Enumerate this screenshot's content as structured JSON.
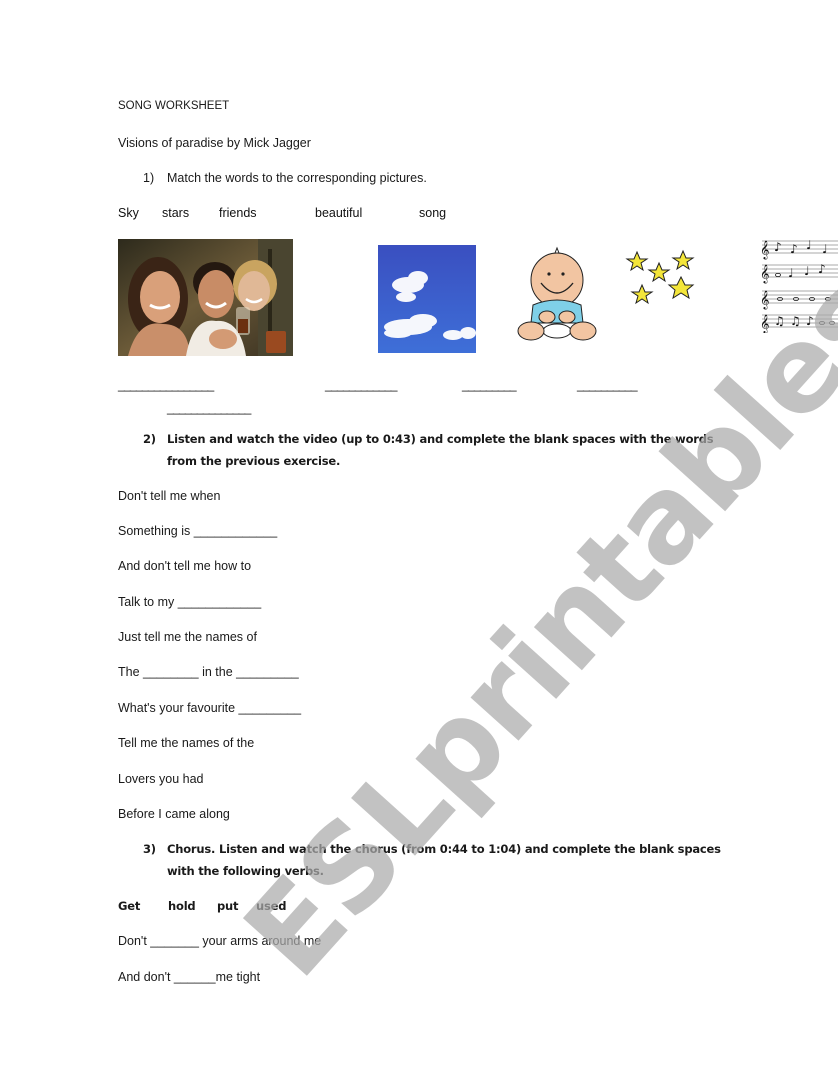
{
  "header": {
    "title": "SONG WORKSHEET",
    "subtitle": "Visions of paradise by Mick Jagger"
  },
  "exercise1": {
    "number": "1)",
    "instruction": "Match the words to the corresponding pictures.",
    "words": [
      "Sky",
      "stars",
      "friends",
      "beautiful",
      "song"
    ],
    "pictures": [
      "friends-photo",
      "sky-photo",
      "baby-clipart",
      "stars-clipart",
      "music-sheet-clipart"
    ],
    "answer_blanks": [
      "________________",
      "____________",
      "_________",
      "__________",
      "______________"
    ]
  },
  "exercise2": {
    "number": "2)",
    "instruction_line1": "Listen and watch the video (up to 0:43) and complete the blank spaces with the words",
    "instruction_line2": "from the previous exercise.",
    "lyrics": [
      "Don't tell me when",
      "Something is ____________",
      "And don't tell me how to",
      "Talk to my ____________",
      "Just tell me the names of",
      "The ________ in the _________",
      "What's your favourite _________",
      "Tell me the names of the",
      "Lovers you had",
      "Before I came along"
    ]
  },
  "exercise3": {
    "number": "3)",
    "instruction_line1": "Chorus. Listen and watch the chorus (from 0:44 to 1:04) and complete the blank spaces",
    "instruction_line2": "with the following verbs.",
    "verbs": [
      "Get",
      "hold",
      "put",
      "used"
    ],
    "lyrics": [
      "Don't _______ your arms around me",
      "And don't ______me tight"
    ]
  },
  "watermark": {
    "text": "ESLprintables.com",
    "color": "#aaaaaa"
  }
}
